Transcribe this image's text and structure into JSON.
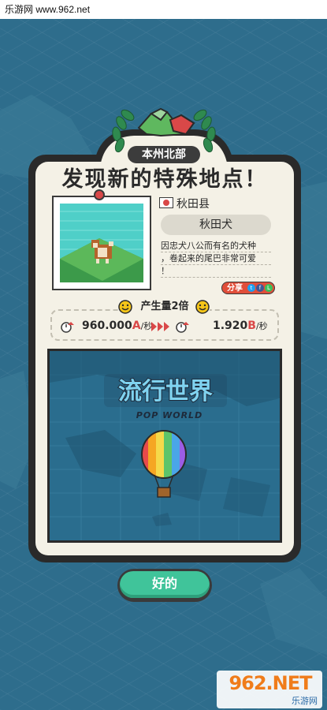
{
  "watermark": {
    "top_text": "乐游网 www.962.net",
    "bottom_big": "962.NET",
    "bottom_small": "乐游网"
  },
  "dialog": {
    "region": "本州北部",
    "title": "发现新的特殊地点！",
    "prefecture": "秋田县",
    "flag_country": "Japan",
    "spot_name": "秋田犬",
    "description_lines": [
      "因忠犬八公而有名的犬种",
      "，卷起来的尾巴非常可爱",
      "！"
    ],
    "share_label": "分享",
    "share_icons": [
      "twitter-icon",
      "facebook-icon",
      "line-icon"
    ],
    "production": {
      "title": "产生量2倍",
      "from_value": "960.000",
      "from_unit": "A",
      "to_value": "1.920",
      "to_unit": "B",
      "per": "/秒"
    },
    "map": {
      "logo_text": "流行世界",
      "subtitle": "POP WORLD"
    },
    "ok_label": "好的"
  },
  "colors": {
    "ocean": "#2e6d8c",
    "card": "#f4f1e6",
    "accent_red": "#d94848",
    "ok_green": "#40c49a",
    "smiley_yellow": "#f5c518"
  }
}
